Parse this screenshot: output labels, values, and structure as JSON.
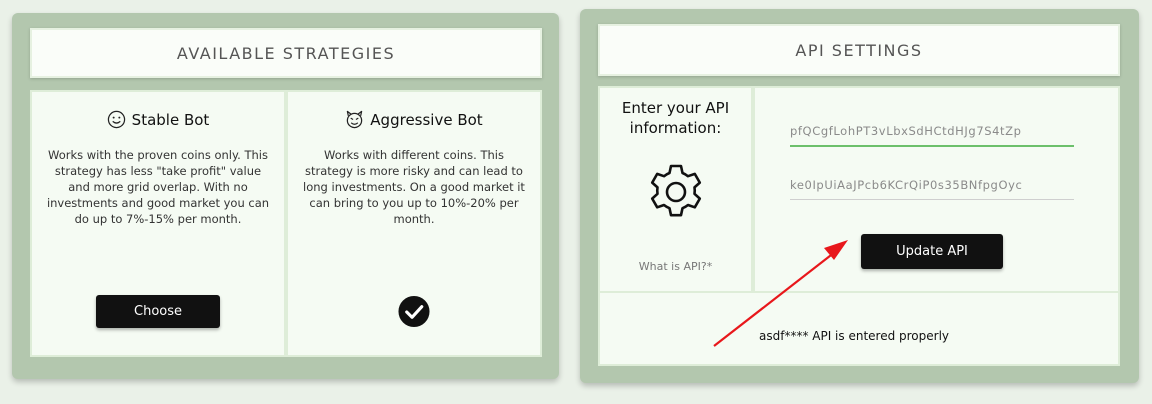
{
  "strategies": {
    "title": "AVAILABLE STRATEGIES",
    "items": [
      {
        "emoji": "🙂",
        "icon": "smiley-icon",
        "name": "Stable Bot",
        "description": "Works with the proven coins only. This strategy has less \"take profit\" value and more grid overlap. With no investments and good market you can do up to 7%-15% per month.",
        "action_label": "Choose"
      },
      {
        "emoji": "😈",
        "icon": "devil-icon",
        "name": "Aggressive Bot",
        "description": "Works with different coins. This strategy is more risky and can lead to long investments. On a good market it can bring to you up to 10%-20% per month.",
        "selected": true
      }
    ]
  },
  "api": {
    "title": "API SETTINGS",
    "prompt": "Enter your API information:",
    "help_link": "What is API?*",
    "key_value": "pfQCgfLohPT3vLbxSdHCtdHJg7S4tZp",
    "secret_value": "ke0IpUiAaJPcb6KCrQiP0s35BNfpgOyc",
    "update_label": "Update API",
    "status": "asdf**** API is entered properly"
  },
  "colors": {
    "card": "#b3c7ae",
    "panel": "#f5fbf3",
    "accent_green": "#6cc06b",
    "button": "#111111",
    "annotation_arrow": "#e8171b"
  }
}
